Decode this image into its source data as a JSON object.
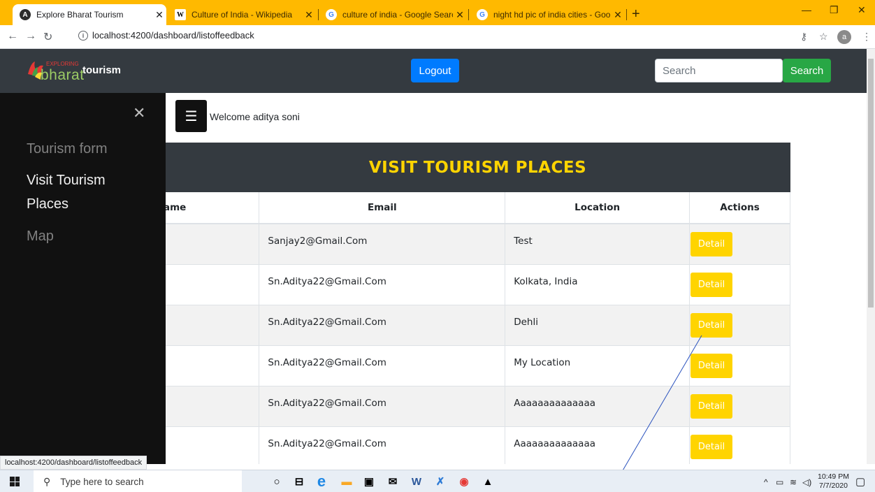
{
  "browser": {
    "tabs": [
      {
        "title": "Explore Bharat Tourism",
        "active": true
      },
      {
        "title": "Culture of India - Wikipedia",
        "active": false
      },
      {
        "title": "culture of india - Google Search",
        "active": false
      },
      {
        "title": "night hd pic of india cities - Goo",
        "active": false
      }
    ],
    "url": "localhost:4200/dashboard/listoffeedback",
    "profile_initial": "a"
  },
  "navbar": {
    "brand_small": "EXPLORING",
    "brand_main": "bharat",
    "brand_text": "tourism",
    "logout_label": "Logout",
    "search_placeholder": "Search",
    "search_button": "Search"
  },
  "main": {
    "welcome": "Welcome aditya soni",
    "table_title": "VISIT TOURISM PLACES",
    "columns": [
      "ame",
      "Email",
      "Location",
      "Actions"
    ],
    "rows": [
      {
        "email": "Sanjay2@Gmail.Com",
        "location": "Test",
        "action": "Detail"
      },
      {
        "email": "Sn.Aditya22@Gmail.Com",
        "location": "Kolkata, India",
        "action": "Detail"
      },
      {
        "email": "Sn.Aditya22@Gmail.Com",
        "location": "Dehli",
        "action": "Detail"
      },
      {
        "email": "Sn.Aditya22@Gmail.Com",
        "location": "My Location",
        "action": "Detail"
      },
      {
        "email": "Sn.Aditya22@Gmail.Com",
        "location": "Aaaaaaaaaaaaaa",
        "action": "Detail"
      },
      {
        "email": "Sn.Aditya22@Gmail.Com",
        "location": "Aaaaaaaaaaaaaa",
        "action": "Detail"
      }
    ]
  },
  "sidebar": {
    "items": [
      {
        "label": "Tourism form"
      },
      {
        "label": "Visit Tourism"
      },
      {
        "label": "Places"
      },
      {
        "label": "Map"
      }
    ]
  },
  "status_bar_url": "localhost:4200/dashboard/listoffeedback",
  "taskbar": {
    "search_placeholder": "Type here to search",
    "time": "10:49 PM",
    "date": "7/7/2020"
  },
  "colors": {
    "tabstrip": "#ffb900",
    "navbar": "#343a40",
    "accent_yellow": "#ffd400",
    "logout_blue": "#007bff",
    "search_green": "#28a745",
    "sidebar": "#111111"
  }
}
